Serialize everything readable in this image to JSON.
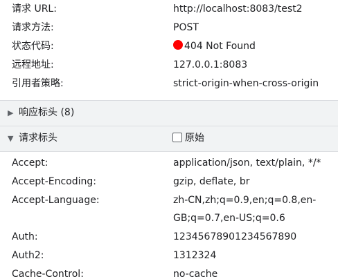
{
  "general": {
    "items": [
      {
        "label": "请求 URL:",
        "value": "http://localhost:8083/test2"
      },
      {
        "label": "请求方法:",
        "value": "POST"
      },
      {
        "label": "状态代码:",
        "value": "404 Not Found"
      },
      {
        "label": "远程地址:",
        "value": "127.0.0.1:8083"
      },
      {
        "label": "引用者策略:",
        "value": "strict-origin-when-cross-origin"
      }
    ]
  },
  "response_section": {
    "toggle": "▶",
    "title": "响应标头 (8)"
  },
  "request_section": {
    "toggle": "▼",
    "title": "请求标头",
    "raw_label": "原始"
  },
  "request_headers": [
    {
      "label": "Accept:",
      "value": "application/json, text/plain, */*"
    },
    {
      "label": "Accept-Encoding:",
      "value": "gzip, deflate, br"
    },
    {
      "label": "Accept-Language:",
      "value": "zh-CN,zh;q=0.9,en;q=0.8,en-GB;q=0.7,en-US;q=0.6"
    },
    {
      "label": "Auth:",
      "value": "12345678901234567890"
    },
    {
      "label": "Auth2:",
      "value": "1312324"
    },
    {
      "label": "Cache-Control:",
      "value": "no-cache"
    }
  ],
  "colors": {
    "status_dot": "#ff0000",
    "section_bg": "#f1f3f4"
  }
}
